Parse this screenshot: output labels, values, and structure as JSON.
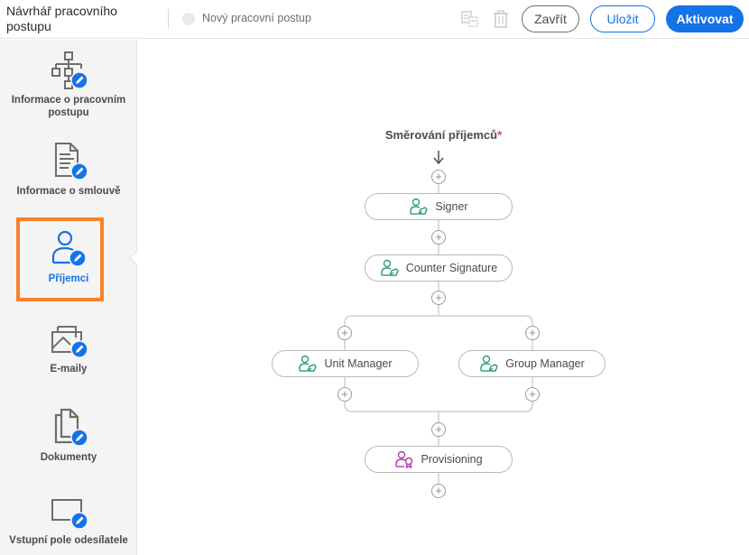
{
  "header": {
    "app_title": "Návrhář pracovního postupu",
    "workflow_name": "Nový pracovní postup",
    "buttons": {
      "close": "Zavřít",
      "save": "Uložit",
      "activate": "Aktivovat"
    },
    "icons": [
      "duplicate-icon",
      "delete-icon"
    ]
  },
  "sidebar": {
    "items": [
      {
        "label": "Informace o pracovním postupu",
        "icon": "workflow-info-icon",
        "active": false
      },
      {
        "label": "Informace o smlouvě",
        "icon": "agreement-info-icon",
        "active": false
      },
      {
        "label": "Příjemci",
        "icon": "recipients-icon",
        "active": true
      },
      {
        "label": "E-maily",
        "icon": "emails-icon",
        "active": false
      },
      {
        "label": "Dokumenty",
        "icon": "documents-icon",
        "active": false
      },
      {
        "label": "Vstupní pole odesílatele",
        "icon": "sender-fields-icon",
        "active": false
      }
    ]
  },
  "routing": {
    "title": "Směrování příjemců",
    "required_marker": "*",
    "nodes": [
      {
        "label": "Signer",
        "role": "signer"
      },
      {
        "label": "Counter Signature",
        "role": "signer"
      },
      {
        "label": "Unit Manager",
        "role": "signer"
      },
      {
        "label": "Group Manager",
        "role": "signer"
      },
      {
        "label": "Provisioning",
        "role": "certified-recipient"
      }
    ]
  },
  "colors": {
    "accent": "#1473e6",
    "active_highlight": "#f5822a",
    "signer_icon": "#2d9d78",
    "provisioning_icon": "#b03ca8",
    "required": "#e34850"
  }
}
